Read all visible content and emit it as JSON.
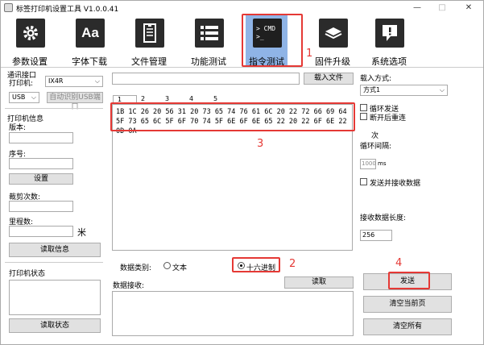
{
  "window": {
    "title": "标签打印机设置工具 V1.0.0.41",
    "minimize": "—",
    "maximize": "□",
    "close": "✕"
  },
  "toolbar": {
    "items": [
      {
        "label": "参数设置",
        "icon": "gear-icon"
      },
      {
        "label": "字体下载",
        "icon": "font-icon",
        "glyph": "Aa"
      },
      {
        "label": "文件管理",
        "icon": "document-icon"
      },
      {
        "label": "功能测试",
        "icon": "list-icon"
      },
      {
        "label": "指令测试",
        "icon": "cmd-icon",
        "glyph": "> CMD\n>_"
      },
      {
        "label": "固件升级",
        "icon": "chip-icon"
      },
      {
        "label": "系统选项",
        "icon": "alert-icon"
      }
    ],
    "active_index": 4
  },
  "annotations": {
    "n1": "1",
    "n2": "2",
    "n3": "3",
    "n4": "4"
  },
  "left": {
    "comm_group": "通讯接口",
    "printer_label": "打印机:",
    "printer_value": "IX4R",
    "port_value": "USB",
    "auto_usb": "自动识别USB端口",
    "info_group": "打印机信息",
    "version_label": "版本:",
    "serial_label": "序号:",
    "settings_button": "设置",
    "cut_count_label": "裁剪次数:",
    "mileage_label": "里程数:",
    "mileage_unit": "米",
    "read_info_button": "读取信息",
    "status_group": "打印机状态",
    "read_status_button": "读取状态"
  },
  "middle": {
    "path_value": "",
    "load_file_button": "载入文件",
    "tabs": [
      "1",
      "2",
      "3",
      "4",
      "5"
    ],
    "hex_content": "1B 1C 26 20 56 31 20 73 65 74 76 61 6C 20 22 72 66 69 64 5F 73 65 6C 5F 6F 70 74 5F 6E 6F 6E 65 22 20 22 6F 6E 22 0D 0A",
    "data_type_label": "数据类别:",
    "type_text": "文本",
    "type_hex": "十六进制",
    "selected_type": "hex",
    "receive_label": "数据接收:",
    "read_button": "读取"
  },
  "right": {
    "load_mode_label": "载入方式:",
    "load_mode_value": "方式1",
    "loop_send": "循环发送",
    "reconnect": "断开后重连",
    "times_label": "次",
    "loop_interval_label": "循环间隔:",
    "interval_value": "1000",
    "interval_unit": "ms",
    "send_and_receive": "发送并接收数据",
    "receive_length_label": "接收数据长度:",
    "receive_length_value": "256",
    "send_button": "发送",
    "clear_current_button": "清空当前页",
    "clear_all_button": "清空所有"
  }
}
